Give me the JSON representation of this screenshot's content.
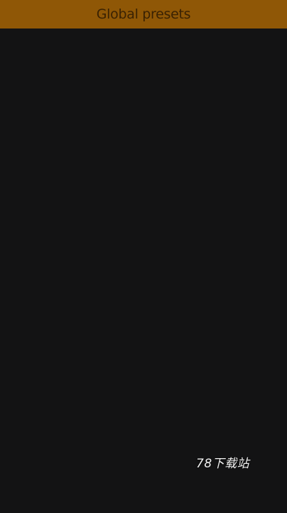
{
  "header": {
    "title": "Global presets"
  },
  "watermark": {
    "text": "78下载站"
  },
  "colors": {
    "title_bar": "#8f5706",
    "title_text": "#3a2203",
    "background": "#121213"
  }
}
